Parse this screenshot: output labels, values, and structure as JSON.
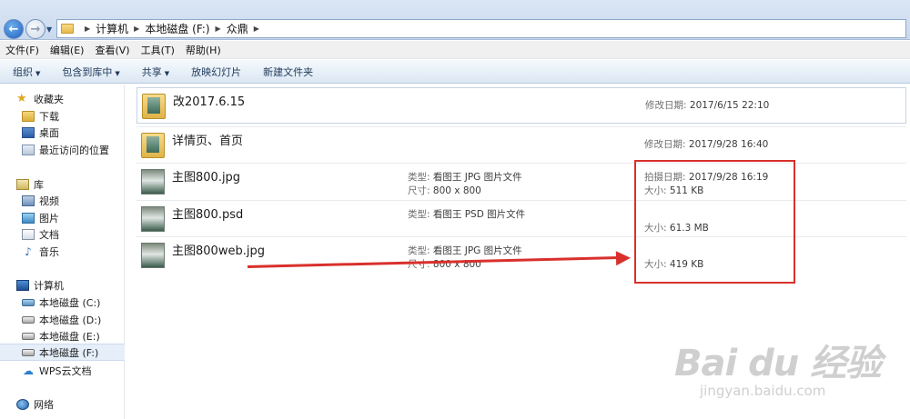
{
  "address": {
    "crumbs": [
      "计算机",
      "本地磁盘 (F:)",
      "众鼎"
    ]
  },
  "menu": [
    "文件(F)",
    "编辑(E)",
    "查看(V)",
    "工具(T)",
    "帮助(H)"
  ],
  "toolbar": {
    "organize": "组织",
    "include_library": "包含到库中",
    "share": "共享",
    "slideshow": "放映幻灯片",
    "new_folder": "新建文件夹"
  },
  "sidebar": {
    "favorites": "收藏夹",
    "downloads": "下载",
    "desktop": "桌面",
    "recent": "最近访问的位置",
    "libraries": "库",
    "videos": "视频",
    "pictures": "图片",
    "documents": "文档",
    "music": "音乐",
    "computer": "计算机",
    "drive_c": "本地磁盘 (C:)",
    "drive_d": "本地磁盘 (D:)",
    "drive_e": "本地磁盘 (E:)",
    "drive_f": "本地磁盘 (F:)",
    "wps": "WPS云文档",
    "network": "网络"
  },
  "files": [
    {
      "name": "改2017.6.15",
      "date_label": "修改日期:",
      "date": "2017/6/15 22:10"
    },
    {
      "name": "详情页、首页",
      "date_label": "修改日期:",
      "date": "2017/9/28 16:40"
    },
    {
      "name": "主图800.jpg",
      "type_label": "类型:",
      "type": "看图王 JPG 图片文件",
      "dim_label": "尺寸:",
      "dim": "800 x 800",
      "date_label": "拍摄日期:",
      "date": "2017/9/28 16:19",
      "size_label": "大小:",
      "size": "511 KB"
    },
    {
      "name": "主图800.psd",
      "type_label": "类型:",
      "type": "看图王 PSD 图片文件",
      "size_label": "大小:",
      "size": "61.3 MB"
    },
    {
      "name": "主图800web.jpg",
      "type_label": "类型:",
      "type": "看图王 JPG 图片文件",
      "dim_label": "尺寸:",
      "dim": "800 x 800",
      "size_label": "大小:",
      "size": "419 KB"
    }
  ],
  "watermark": {
    "logo": "Bai du 经验",
    "url": "jingyan.baidu.com"
  },
  "colors": {
    "annotation": "#d9302c",
    "selection": "#e5eef9"
  }
}
